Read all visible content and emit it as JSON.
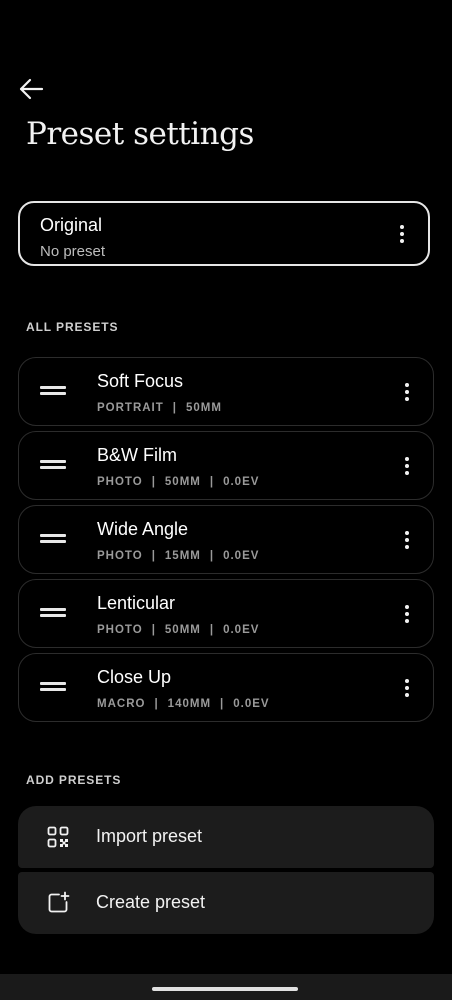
{
  "header": {
    "back_icon": "arrow-left-icon",
    "title": "Preset settings"
  },
  "original": {
    "title": "Original",
    "subtitle": "No preset",
    "menu_icon": "more-vertical-icon"
  },
  "all_presets": {
    "label": "ALL PRESETS",
    "items": [
      {
        "name": "Soft Focus",
        "meta": [
          "PORTRAIT",
          "50MM"
        ]
      },
      {
        "name": "B&W Film",
        "meta": [
          "PHOTO",
          "50MM",
          "0.0EV"
        ]
      },
      {
        "name": "Wide Angle",
        "meta": [
          "PHOTO",
          "15MM",
          "0.0EV"
        ]
      },
      {
        "name": "Lenticular",
        "meta": [
          "PHOTO",
          "50MM",
          "0.0EV"
        ]
      },
      {
        "name": "Close Up",
        "meta": [
          "MACRO",
          "140MM",
          "0.0EV"
        ]
      }
    ],
    "separator": "|"
  },
  "add_presets": {
    "label": "ADD PRESETS",
    "import_label": "Import preset",
    "import_icon": "qr-code-icon",
    "create_label": "Create preset",
    "create_icon": "add-box-icon"
  },
  "colors": {
    "background": "#000000",
    "card_border": "#2c2c2c",
    "selected_border": "#e6e6e6",
    "add_card_bg": "#1c1c1c",
    "meta_text": "#9a9a9a"
  }
}
